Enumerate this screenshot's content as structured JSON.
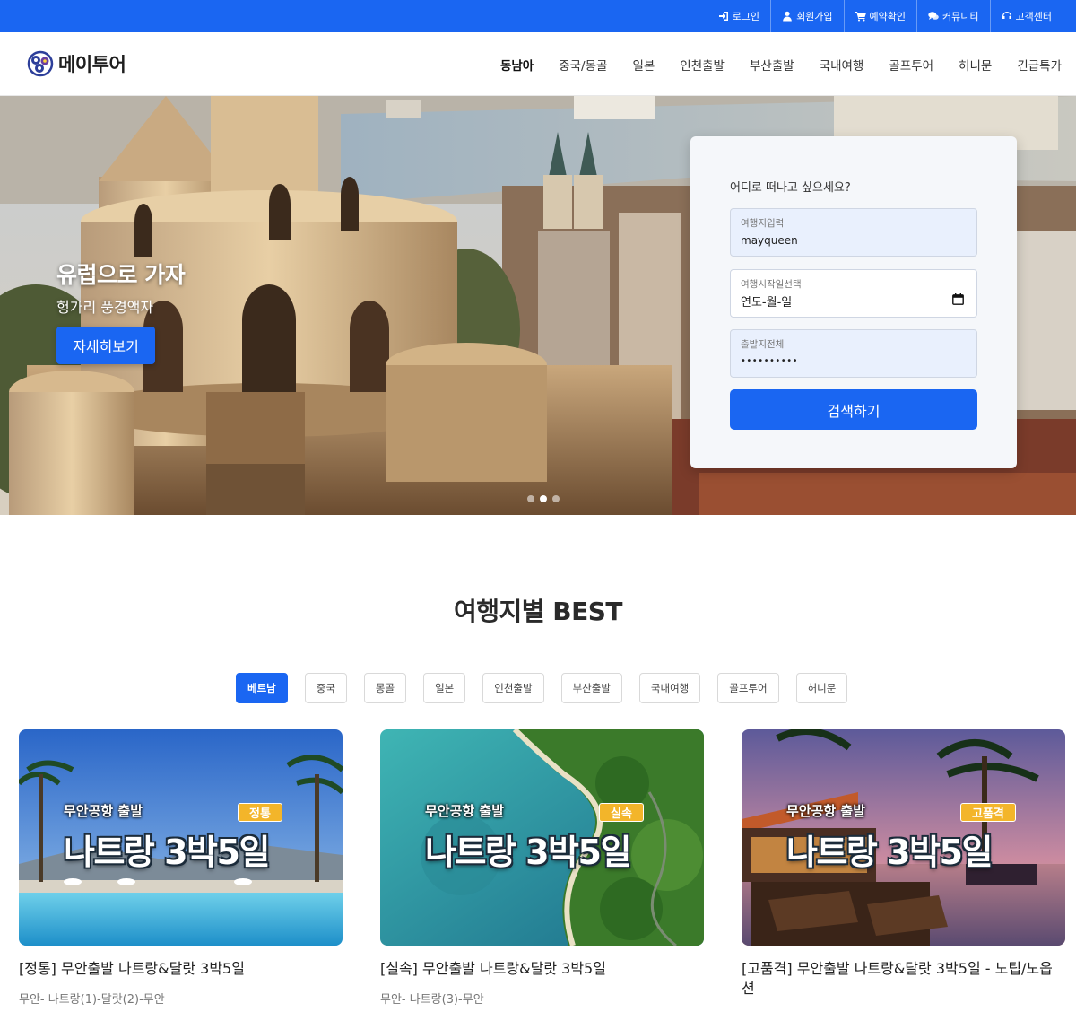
{
  "topbar": {
    "items": [
      {
        "label": "로그인",
        "icon": "login-icon"
      },
      {
        "label": "회원가입",
        "icon": "user-icon"
      },
      {
        "label": "예약확인",
        "icon": "cart-icon"
      },
      {
        "label": "커뮤니티",
        "icon": "chat-icon"
      },
      {
        "label": "고객센터",
        "icon": "headset-icon"
      }
    ],
    "color": "#1a66f2"
  },
  "header": {
    "logo_text": "메이투어",
    "nav": [
      "동남아",
      "중국/몽골",
      "일본",
      "인천출발",
      "부산출발",
      "국내여행",
      "골프투어",
      "허니문",
      "긴급특가"
    ]
  },
  "hero": {
    "title": "유럽으로 가자",
    "subtitle": "헝가리 풍경액자",
    "button": "자세히보기",
    "slide_count": 3,
    "active_slide": 2
  },
  "search": {
    "prompt": "어디로 떠나고 싶으세요?",
    "destination": {
      "label": "여행지입력",
      "value": "mayqueen"
    },
    "start_date": {
      "label": "여행시작일선택",
      "value": "연도-월-일"
    },
    "departure": {
      "label": "출발지전체",
      "value": "••••••••••"
    },
    "button": "검색하기"
  },
  "best": {
    "title": "여행지별 BEST",
    "tabs": [
      "베트남",
      "중국",
      "몽골",
      "일본",
      "인천출발",
      "부산출발",
      "국내여행",
      "골프투어",
      "허니문"
    ],
    "active_tab": "베트남",
    "cards": [
      {
        "from": "무안공항 출발",
        "badge": "정통",
        "headline": "나트랑 3박5일",
        "title": "[정통] 무안출발 나트랑&달랏 3박5일",
        "route": "무안- 나트랑(1)-달랏(2)-무안"
      },
      {
        "from": "무안공항 출발",
        "badge": "실속",
        "headline": "나트랑 3박5일",
        "title": "[실속] 무안출발 나트랑&달랏 3박5일",
        "route": "무안- 나트랑(3)-무안"
      },
      {
        "from": "무안공항 출발",
        "badge": "고품격",
        "headline": "나트랑 3박5일",
        "title": "[고품격] 무안출발 나트랑&달랏 3박5일 - 노팁/노옵션",
        "route": ""
      }
    ]
  }
}
